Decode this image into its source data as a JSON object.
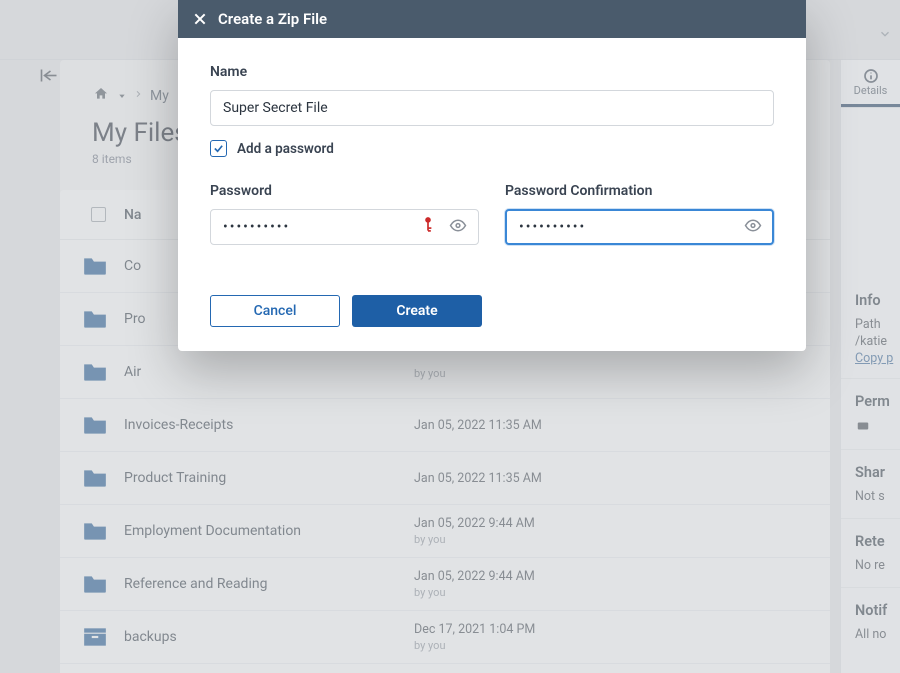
{
  "breadcrumb": {
    "item": "My"
  },
  "page": {
    "title": "My Files",
    "item_count": "8 items"
  },
  "list_header": {
    "name_col": "Na"
  },
  "files": [
    {
      "name": "Co",
      "date": "",
      "by": ""
    },
    {
      "name": "Pro",
      "date": "",
      "by": ""
    },
    {
      "name": "Air",
      "date": "",
      "by": "by you"
    },
    {
      "name": "Invoices-Receipts",
      "date": "Jan 05, 2022 11:35 AM",
      "by": ""
    },
    {
      "name": "Product Training",
      "date": "Jan 05, 2022 11:35 AM",
      "by": ""
    },
    {
      "name": "Employment Documentation",
      "date": "Jan 05, 2022 9:44 AM",
      "by": "by you"
    },
    {
      "name": "Reference and Reading",
      "date": "Jan 05, 2022 9:44 AM",
      "by": "by you"
    },
    {
      "name": "backups",
      "date": "Dec 17, 2021 1:04 PM",
      "by": "by you"
    }
  ],
  "side": {
    "tab_details": "Details",
    "info_h": "Info",
    "path_label": "Path",
    "path_value": "/katie",
    "copy_link": "Copy p",
    "perm_h": "Perm",
    "share_h": "Shar",
    "share_v": "Not s",
    "rete_h": "Rete",
    "rete_v": "No re",
    "notif_h": "Notif",
    "notif_v": "All no"
  },
  "modal": {
    "title": "Create a Zip File",
    "name_label": "Name",
    "name_value": "Super Secret File",
    "add_pw_label": "Add a password",
    "pw_label": "Password",
    "pw_conf_label": "Password Confirmation",
    "pw_value": "••••••••••",
    "pw_conf_value": "••••••••••",
    "cancel": "Cancel",
    "create": "Create"
  }
}
